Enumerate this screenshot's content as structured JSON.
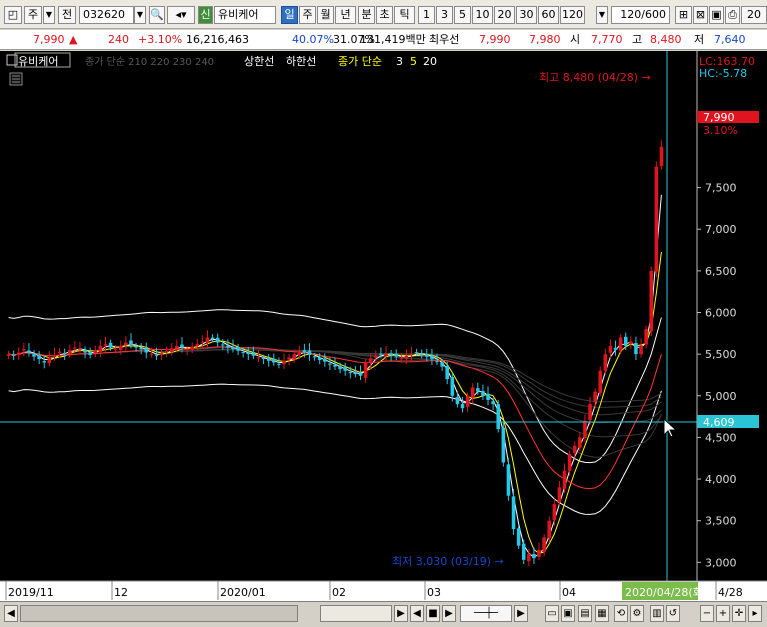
{
  "toolbar": {
    "mode": "주",
    "prev": "전",
    "code": "032620",
    "flag": "신",
    "name": "유비케어",
    "periods": [
      "일",
      "주",
      "월",
      "년",
      "분",
      "초",
      "틱"
    ],
    "intervals": [
      "1",
      "3",
      "5",
      "10",
      "20",
      "30",
      "60",
      "120"
    ],
    "count": "120/600",
    "extra": "20"
  },
  "quote": {
    "price": "7,990",
    "arrow": "▲",
    "change": "240",
    "pct": "+3.10%",
    "volume": "16,216,463",
    "turnover": "40.07%",
    "ratio": "31.07%",
    "amount": "131,419백만",
    "best_label": "최우선",
    "ask": "7,990",
    "bid": "7,980",
    "open_label": "시",
    "open": "7,770",
    "high_label": "고",
    "high": "8,480",
    "low_label": "저",
    "low": "7,640"
  },
  "legend": {
    "title": "유비케어",
    "indicator": "종가 단순 210 220 230 240",
    "upper": "상한선",
    "lower": "하한선",
    "ma_label": "종가 단순",
    "ma3": "3",
    "ma5": "5",
    "ma20": "20"
  },
  "annotations": {
    "high": "최고 8,480 (04/28) →",
    "low": "최저 3,030 (03/19) →"
  },
  "right_axis": {
    "lc": "LC:163.70",
    "hc": "HC:-5.78",
    "price": "7,990",
    "pct": "3.10%",
    "cursor": "4,609",
    "ticks": [
      "7,500",
      "7,000",
      "6,500",
      "6,000",
      "5,500",
      "5,000",
      "4,500",
      "4,000",
      "3,500",
      "3,000"
    ]
  },
  "x_axis": {
    "labels": [
      "2019/11",
      "12",
      "2020/01",
      "02",
      "03",
      "04",
      "4/28"
    ],
    "cursor_date": "2020/04/28(화)"
  },
  "colors": {
    "up": "#e0141e",
    "down": "#27c8e8",
    "bg": "#000000",
    "crosshair": "#2bc4d4",
    "ma3": "#ffffff",
    "ma5": "#ffff00",
    "ma20": "#ff3333"
  },
  "chart_data": {
    "type": "candlestick",
    "title": "유비케어",
    "ylim": [
      2800,
      8900
    ],
    "series": [
      {
        "name": "종가",
        "values": [
          5500,
          5480,
          5520,
          5560,
          5510,
          5470,
          5440,
          5400,
          5460,
          5490,
          5530,
          5500,
          5550,
          5580,
          5560,
          5520,
          5490,
          5540,
          5600,
          5620,
          5580,
          5560,
          5600,
          5640,
          5610,
          5580,
          5560,
          5520,
          5500,
          5480,
          5510,
          5540,
          5570,
          5600,
          5580,
          5560,
          5590,
          5620,
          5650,
          5700,
          5680,
          5640,
          5610,
          5580,
          5560,
          5540,
          5520,
          5500,
          5480,
          5460,
          5440,
          5420,
          5400,
          5380,
          5420,
          5460,
          5500,
          5540,
          5520,
          5490,
          5460,
          5430,
          5410,
          5380,
          5350,
          5320,
          5300,
          5280,
          5260,
          5240,
          5400,
          5450,
          5480,
          5500,
          5510,
          5490,
          5470,
          5450,
          5480,
          5500,
          5520,
          5500,
          5470,
          5440,
          5410,
          5350,
          5200,
          5000,
          4900,
          4850,
          5000,
          5100,
          5050,
          5000,
          4950,
          4900,
          4600,
          4200,
          3800,
          3400,
          3200,
          3030,
          3100,
          3050,
          3150,
          3300,
          3500,
          3700,
          3900,
          4100,
          4300,
          4400,
          4500,
          4700,
          4900,
          5050,
          5300,
          5500,
          5600,
          5550,
          5700,
          5600,
          5650,
          5500,
          5600,
          5800,
          6500,
          7750,
          7990
        ]
      }
    ]
  }
}
